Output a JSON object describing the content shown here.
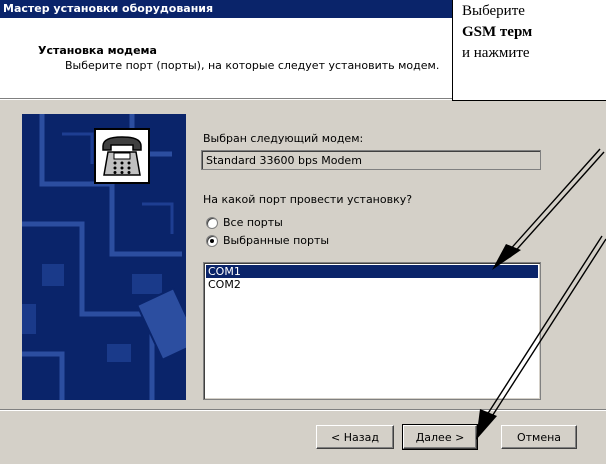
{
  "window": {
    "title": "Мастер установки оборудования"
  },
  "header": {
    "title": "Установка модема",
    "subtitle": "Выберите порт (порты), на которые следует установить модем."
  },
  "icons": {
    "banner": "telephone-icon"
  },
  "modem": {
    "label": "Выбран следующий модем:",
    "value": "Standard 33600 bps Modem"
  },
  "port": {
    "question": "На какой порт провести установку?",
    "options": [
      {
        "label": "Все порты",
        "checked": false
      },
      {
        "label": "Выбранные порты",
        "checked": true
      }
    ],
    "list": [
      "COM1",
      "COM2"
    ],
    "selected": "COM1"
  },
  "buttons": {
    "back": "< Назад",
    "next": "Далее >",
    "cancel": "Отмена"
  },
  "callout": {
    "line1": "Выберите",
    "line2": "GSM терм",
    "line3": "и нажмите"
  },
  "colors": {
    "title_bar": "#0a246a",
    "dialog_bg": "#d4d0c8",
    "selection": "#0a246a"
  }
}
